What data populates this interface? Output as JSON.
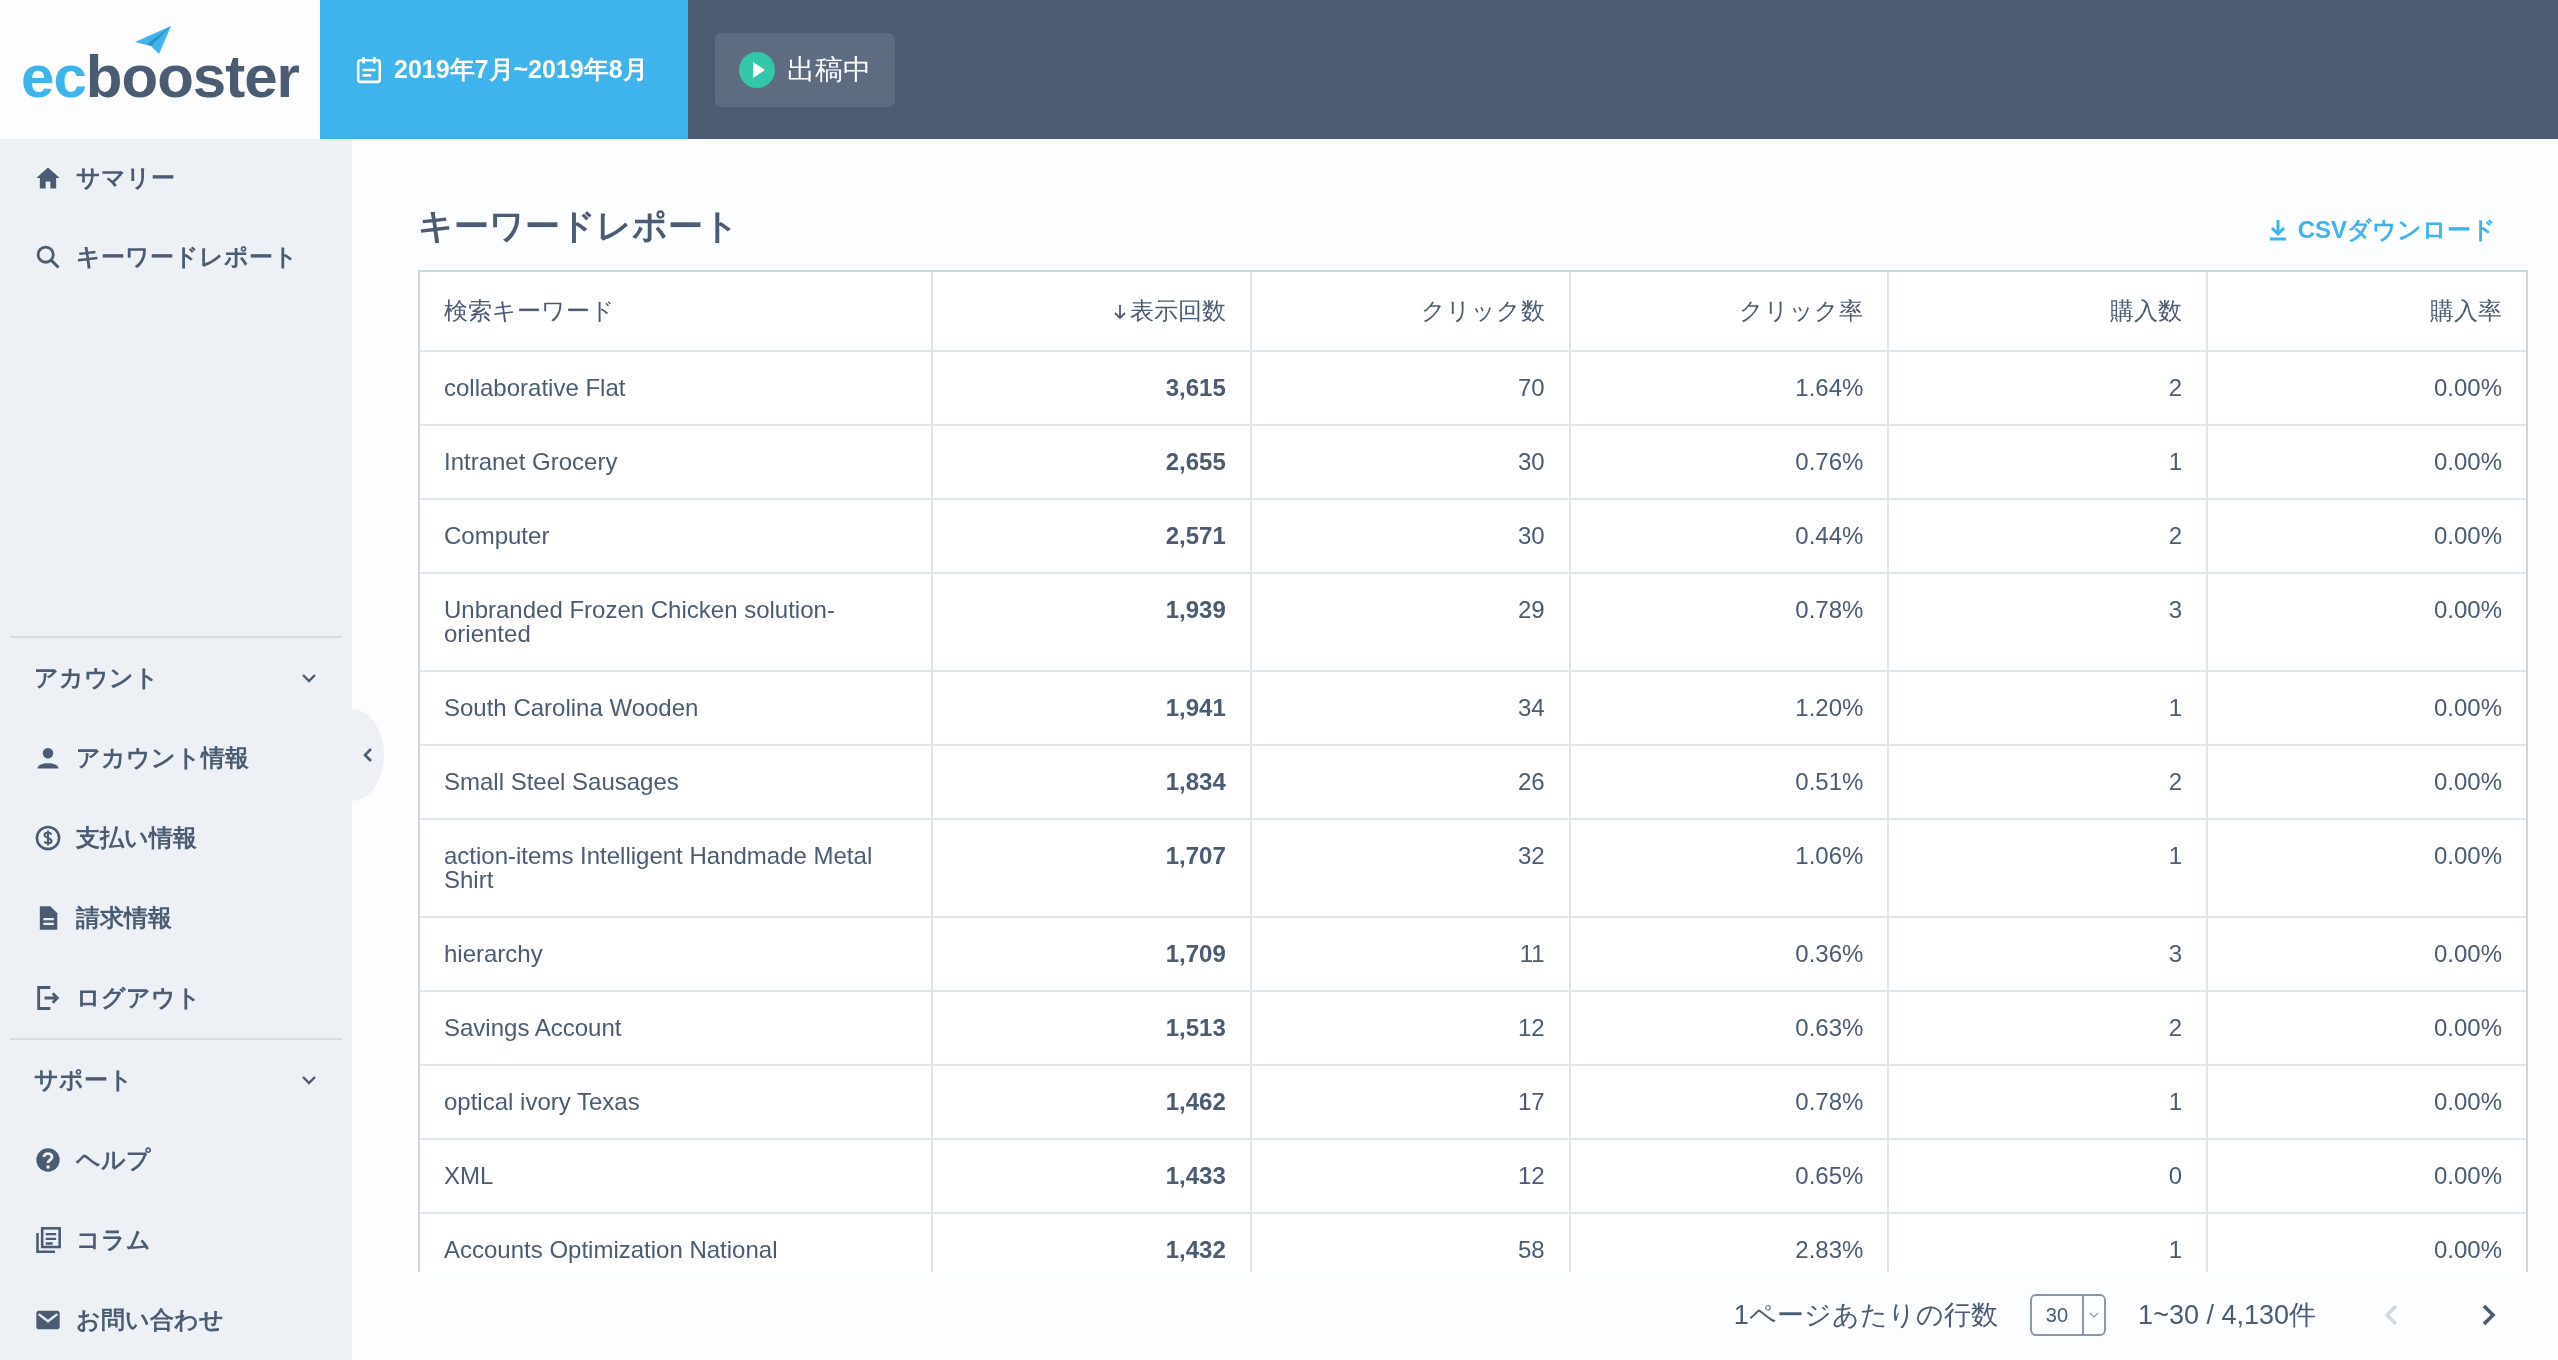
{
  "header": {
    "logo": {
      "part_1": "ec",
      "part_2": "booster"
    },
    "date_range": "2019年7月~2019年8月",
    "status_button": {
      "label": "出稿中",
      "on": true
    }
  },
  "sidebar": {
    "items": [
      {
        "label": "サマリー"
      },
      {
        "label": "キーワードレポート"
      }
    ],
    "sections": [
      {
        "title": "アカウント",
        "expanded": true,
        "items": [
          {
            "label": "アカウント情報"
          },
          {
            "label": "支払い情報"
          },
          {
            "label": "請求情報"
          },
          {
            "label": "ログアウト"
          }
        ]
      },
      {
        "title": "サポート",
        "expanded": true,
        "items": [
          {
            "label": "ヘルプ"
          },
          {
            "label": "コラム"
          },
          {
            "label": "お問い合わせ"
          }
        ]
      }
    ]
  },
  "page": {
    "title": "キーワードレポート",
    "download_link": "CSVダウンロード"
  },
  "table": {
    "columns": [
      {
        "label": "検索キーワード",
        "sorted_descending": false
      },
      {
        "label": "表示回数",
        "sorted_descending": true
      },
      {
        "label": "クリック数",
        "sorted_descending": false
      },
      {
        "label": "クリック率",
        "sorted_descending": false
      },
      {
        "label": "購入数",
        "sorted_descending": false
      },
      {
        "label": "購入率",
        "sorted_descending": false
      }
    ],
    "rows": [
      [
        "collaborative Flat",
        "3,615",
        "70",
        "1.64%",
        "2",
        "0.00%"
      ],
      [
        "Intranet Grocery",
        "2,655",
        "30",
        "0.76%",
        "1",
        "0.00%"
      ],
      [
        "Computer",
        "2,571",
        "30",
        "0.44%",
        "2",
        "0.00%"
      ],
      [
        "Unbranded Frozen Chicken solution-oriented",
        "1,939",
        "29",
        "0.78%",
        "3",
        "0.00%"
      ],
      [
        "South Carolina Wooden",
        "1,941",
        "34",
        "1.20%",
        "1",
        "0.00%"
      ],
      [
        "Small Steel Sausages",
        "1,834",
        "26",
        "0.51%",
        "2",
        "0.00%"
      ],
      [
        "action-items Intelligent Handmade Metal Shirt",
        "1,707",
        "32",
        "1.06%",
        "1",
        "0.00%"
      ],
      [
        "hierarchy",
        "1,709",
        "11",
        "0.36%",
        "3",
        "0.00%"
      ],
      [
        "Savings Account",
        "1,513",
        "12",
        "0.63%",
        "2",
        "0.00%"
      ],
      [
        "optical ivory Texas",
        "1,462",
        "17",
        "0.78%",
        "1",
        "0.00%"
      ],
      [
        "XML",
        "1,433",
        "12",
        "0.65%",
        "0",
        "0.00%"
      ],
      [
        "Accounts Optimization National",
        "1,432",
        "58",
        "2.83%",
        "1",
        "0.00%"
      ]
    ]
  },
  "pagination": {
    "rows_per_page_label": "1ページあたりの行数",
    "rows_per_page": "30",
    "range": "1~30 / 4,130件",
    "previous_disabled": true,
    "next_disabled": false
  }
}
